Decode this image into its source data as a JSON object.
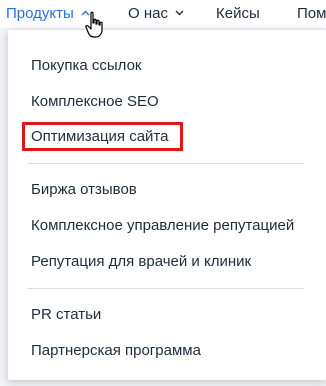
{
  "topnav": {
    "products_label": "Продукты",
    "about_label": "О нас",
    "cases_label": "Кейсы",
    "more_label": "Пом"
  },
  "dropdown": {
    "group1": [
      "Покупка ссылок",
      "Комплексное SEO",
      "Оптимизация сайта"
    ],
    "group2": [
      "Биржа отзывов",
      "Комплексное управление репутацией",
      "Репутация для врачей и клиник"
    ],
    "group3": [
      "PR статьи",
      "Партнерская программа"
    ]
  },
  "colors": {
    "accent": "#2a6fdb",
    "highlight_border": "#e0161b",
    "text": "#1f2c3b"
  },
  "icons": {
    "chevron": "chevron-down-icon",
    "cursor": "hand-pointer-cursor-icon"
  }
}
